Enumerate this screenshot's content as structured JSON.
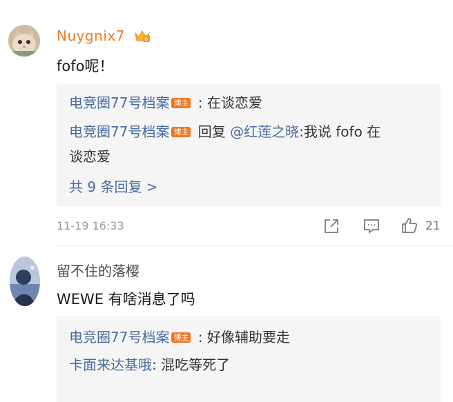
{
  "comments": [
    {
      "username": "Nuygnix7",
      "text": "fofo呢！",
      "replies": [
        {
          "author": "电竞圈77号档案",
          "badge": "博主",
          "sep": " : ",
          "content": "在谈恋爱"
        },
        {
          "author": "电竞圈77号档案",
          "badge": "博主",
          "reply_word": " 回复 ",
          "mention": "@红莲之晓",
          "content": ":我说 fofo 在",
          "content_cont": "谈恋爱"
        }
      ],
      "more_replies": "共 9 条回复 >",
      "timestamp": "11-19 16:33",
      "likes": "21"
    },
    {
      "username": "留不住的落樱",
      "text": "WEWE 有啥消息了吗",
      "replies": [
        {
          "author": "电竞圈77号档案",
          "badge": "博主",
          "sep": " : ",
          "content": "好像辅助要走"
        },
        {
          "author": "卡面来达基哦",
          "sep": ": ",
          "content": "混吃等死了"
        }
      ]
    }
  ],
  "icons": [
    "crown-icon",
    "share-icon",
    "comment-icon",
    "like-icon"
  ],
  "colors": {
    "username_vip": "#ef7a22",
    "link_blue": "#4a6c9c",
    "badge": "#f07626",
    "reply_bg": "#f5f5f5"
  }
}
